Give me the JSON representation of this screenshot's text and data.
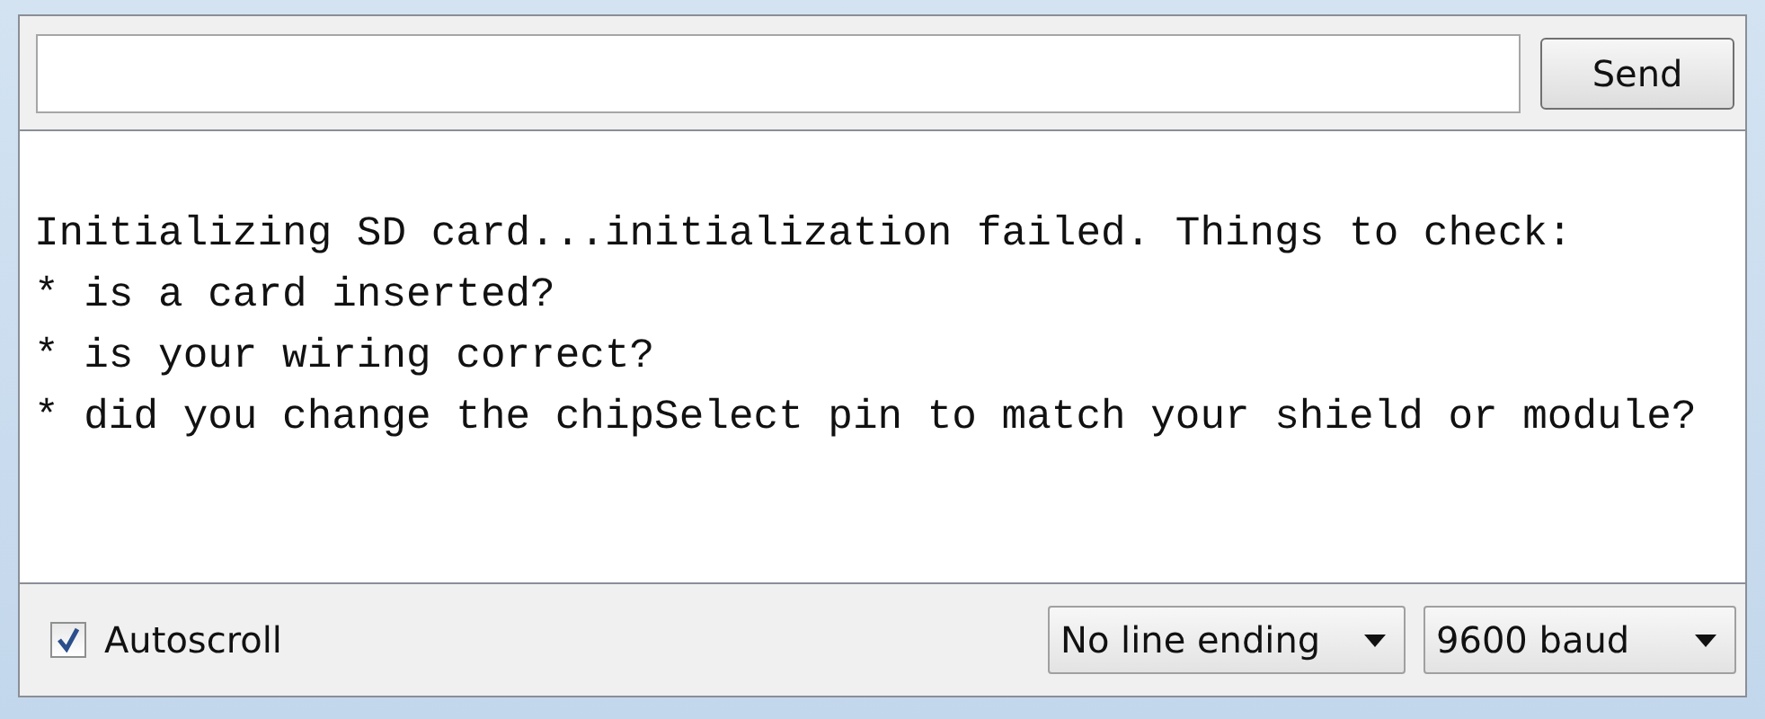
{
  "send_button": "Send",
  "output_lines": [
    "Initializing SD card...initialization failed. Things to check:",
    "* is a card inserted?",
    "* is your wiring correct?",
    "* did you change the chipSelect pin to match your shield or module?"
  ],
  "autoscroll": {
    "label": "Autoscroll",
    "checked": true
  },
  "line_ending": "No line ending",
  "baud": "9600 baud"
}
